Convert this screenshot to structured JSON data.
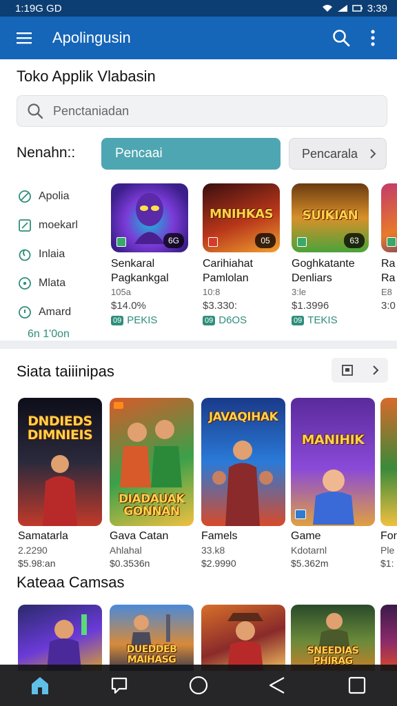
{
  "status": {
    "time": "1:19G GD",
    "right_time": "3:39"
  },
  "appbar": {
    "title": "Apolingusin"
  },
  "page": {
    "title": "Toko Applik Vlabasin"
  },
  "search": {
    "placeholder": "Pencta​niadan"
  },
  "filters": {
    "label": "Nenahn::",
    "primary": "Pencaai",
    "secondary": "Pencarala"
  },
  "side_categories": [
    {
      "label": "Apolia",
      "icon": "leaf-icon"
    },
    {
      "label": "moekarl",
      "icon": "edit-icon"
    },
    {
      "label": "Inlaia",
      "icon": "drop-icon"
    },
    {
      "label": "Mlata",
      "icon": "compass-icon"
    },
    {
      "label": "Amard",
      "icon": "pin-icon"
    }
  ],
  "side_more": "6n 1'0on",
  "featured": [
    {
      "name": "Senkaral",
      "name2": "Pagkankgal",
      "sub": "105a",
      "price": "$14.0%",
      "tag": "PEKIS",
      "badge": "6G",
      "colors": [
        "#3b1f8a",
        "#7a3ad6",
        "#19b8d8"
      ]
    },
    {
      "name": "Carihiahat",
      "name2": "Pamlolan",
      "sub": "10:8",
      "price": "$3.330:",
      "tag": "D6OS",
      "badge": "05",
      "colors": [
        "#3a0f0f",
        "#b8361a",
        "#f0a030"
      ]
    },
    {
      "name": "Goghkatante",
      "name2": "Denliars",
      "sub": "3:le",
      "price": "$1.3996",
      "tag": "TEKIS",
      "badge": "63",
      "colors": [
        "#6a3a10",
        "#d8902a",
        "#4aa33a"
      ]
    },
    {
      "name": "Ra",
      "name2": "Ra",
      "sub": "E8",
      "price": "3:0",
      "tag": "",
      "badge": "",
      "colors": [
        "#c23a6a",
        "#e87a2a",
        "#3a2a8a"
      ]
    }
  ],
  "featured_art": [
    "",
    "MNIHKAS",
    "SUIKIAN",
    ""
  ],
  "section1": {
    "title": "Siata taiiinipas"
  },
  "games": [
    {
      "name": "Samatarla",
      "sub": "2.2290",
      "price": "$5.98:an",
      "art": "DNDIEDS DIMNIEIS",
      "colors": [
        "#0e0e1a",
        "#2a2a3c",
        "#c23a2a"
      ]
    },
    {
      "name": "Gava Catan",
      "sub": "Ahlahal",
      "price": "$0.3536n",
      "art": "DIADAUAK GONNAN",
      "colors": [
        "#d85a2a",
        "#3aa04a",
        "#f0c040"
      ]
    },
    {
      "name": "Famels",
      "sub": "33.k8",
      "price": "$2.9990",
      "art": "JAVAQIHAK",
      "colors": [
        "#1a3a8a",
        "#2a7ad8",
        "#d84a2a"
      ]
    },
    {
      "name": "Game",
      "sub": "Kdotarnl",
      "price": "$5.362m",
      "art": "MANIHIK",
      "colors": [
        "#5a2a9a",
        "#8a4ad8",
        "#e0a040"
      ]
    },
    {
      "name": "For",
      "sub": "Ple",
      "price": "$1:",
      "art": "",
      "colors": [
        "#d86a2a",
        "#3a8a3a",
        "#f0c040"
      ]
    }
  ],
  "section2": {
    "title": "Kateaa Camsas"
  },
  "games2": [
    {
      "art": "",
      "colors": [
        "#2a2a6a",
        "#6a3ad8",
        "#d8a030"
      ]
    },
    {
      "art": "DUEDDEB MAIHASG",
      "colors": [
        "#4a8ad8",
        "#d88a3a",
        "#3a3a4a"
      ]
    },
    {
      "art": "",
      "colors": [
        "#d8702a",
        "#8a2a2a",
        "#f0c060"
      ]
    },
    {
      "art": "SNEEDIAS PHIRAG",
      "colors": [
        "#2a4a2a",
        "#6a8a3a",
        "#c8802a"
      ]
    },
    {
      "art": "",
      "colors": [
        "#3a1a4a",
        "#8a2a6a",
        "#d84a2a"
      ]
    }
  ],
  "nav": [
    "home-icon",
    "chat-icon",
    "circle-icon",
    "back-icon",
    "square-icon"
  ],
  "accent": "#1565b8",
  "teal": "#4ea6b2"
}
